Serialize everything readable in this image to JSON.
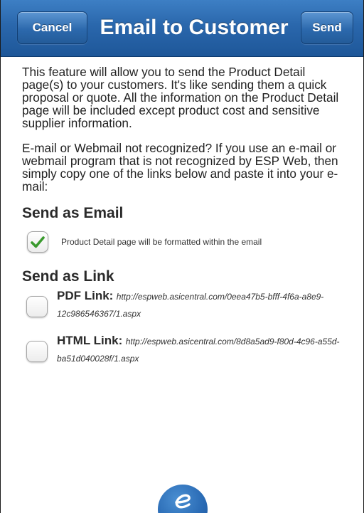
{
  "header": {
    "cancel_label": "Cancel",
    "title": "Email to Customer",
    "send_label": "Send"
  },
  "intro": {
    "paragraph1": "This feature will allow you to send the Product Detail page(s) to your customers. It's like sending them a quick proposal or quote. All the information on the Product Detail page will be included except product cost and sensitive supplier information.",
    "paragraph2": "E-mail or Webmail not recognized? If you use an e-mail or webmail program that is not recognized by ESP Web, then simply copy one of the links below and paste it into your e-mail:"
  },
  "send_as_email": {
    "heading": "Send as Email",
    "option_label": "Product Detail page will be formatted within the email",
    "checked": true
  },
  "send_as_link": {
    "heading": "Send as Link",
    "pdf": {
      "label": "PDF Link:",
      "url": "http://espweb.asicentral.com/0eea47b5-bfff-4f6a-a8e9-12c986546367/1.aspx",
      "checked": false
    },
    "html": {
      "label": "HTML Link:",
      "url": "http://espweb.asicentral.com/8d8a5ad9-f80d-4c96-a55d-ba51d040028f/1.aspx",
      "checked": false
    }
  },
  "colors": {
    "header_blue": "#2a67ac",
    "check_green": "#3a9a2e"
  },
  "logo": {
    "icon": "esp-logo-icon"
  }
}
